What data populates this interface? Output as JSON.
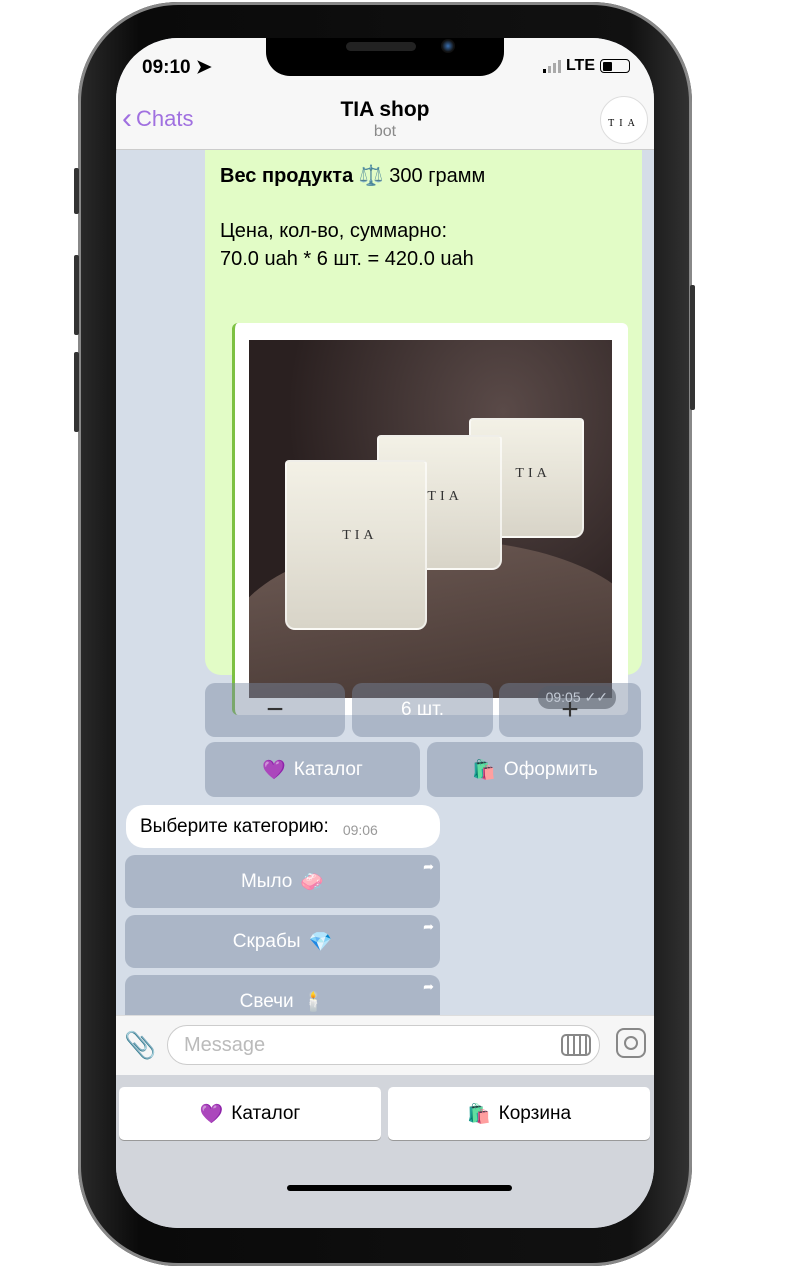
{
  "status": {
    "time": "09:10",
    "network": "LTE"
  },
  "header": {
    "back_label": "Chats",
    "title": "TIA shop",
    "subtitle": "bot",
    "avatar_text": "TIA"
  },
  "message": {
    "weight_label": "Вес продукта",
    "weight_emoji": "⚖️",
    "weight_value": "300 грамм",
    "price_label": "Цена, кол-во, суммарно:",
    "price_value": "70.0 uah * 6 шт. = 420.0 uah",
    "candle_label": "TIA",
    "time": "09:05"
  },
  "inline_keyboard": {
    "minus": "−",
    "quantity": "6 шт.",
    "plus": "+",
    "catalog": "Каталог",
    "catalog_emoji": "💜",
    "checkout": "Оформить",
    "checkout_emoji": "🛍️"
  },
  "category_message": {
    "text": "Выберите категорию:",
    "time": "09:06"
  },
  "categories": [
    {
      "label": "Мыло",
      "emoji": "🧼"
    },
    {
      "label": "Скрабы",
      "emoji": "💎"
    },
    {
      "label": "Свечи",
      "emoji": "🕯️"
    }
  ],
  "input": {
    "placeholder": "Message"
  },
  "reply_keyboard": {
    "catalog": "Каталог",
    "catalog_emoji": "💜",
    "cart": "Корзина",
    "cart_emoji": "🛍️"
  },
  "colors": {
    "accent": "#a070e0",
    "bubble_out": "#e2fcc6",
    "chat_bg": "#d5dde8"
  }
}
